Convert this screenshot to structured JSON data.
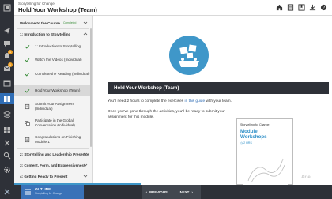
{
  "header": {
    "breadcrumb": "Storytelling for Change",
    "title": "Hold Your Workshop (Team)",
    "icons": [
      "home-icon",
      "notes-icon",
      "bookmark-icon",
      "download-icon",
      "help-icon"
    ]
  },
  "rail": {
    "icons": [
      "logo-icon",
      "send-icon",
      "chat-icon",
      "bell-icon",
      "mail-icon",
      "calendar-icon",
      "book-icon",
      "stack-icon",
      "grid-icon",
      "layers-icon",
      "search-icon",
      "settings-icon"
    ],
    "badges": [
      "1",
      "1"
    ]
  },
  "sidebar": {
    "welcome": {
      "label": "Welcome to the Course",
      "tag": "Completed"
    },
    "module1": {
      "label": "1: Introduction to Storytelling",
      "items": [
        {
          "label": "1: Introduction to Storytelling",
          "status": "done"
        },
        {
          "label": "Watch the Videos (Individual)",
          "status": "done"
        },
        {
          "label": "Complete the Reading (Individual)",
          "status": "done"
        },
        {
          "label": "Hold Your Workshop (Team)",
          "status": "current"
        },
        {
          "label": "Submit Your Assignment (Individual)",
          "status": "todo"
        },
        {
          "label": "Participate in the Global Conversation (Individual)",
          "status": "todo"
        },
        {
          "label": "Congratulations on Finishing Module 1",
          "status": "todo"
        }
      ]
    },
    "modules": [
      "2: Storytelling and Leadership Presence",
      "3: Content, Form, and Expressiveness",
      "4: Getting Ready to Present"
    ]
  },
  "main": {
    "banner": "Hold Your Workshop (Team)",
    "para1_pre": "You'll need 2 hours to complete the exercises ",
    "para1_link": "in this guide",
    "para1_post": " with your team.",
    "para2": "Once you've gone through the activities, you'll be ready to submit your assignment for this module.",
    "book": {
      "series": "Storytelling for Change",
      "title_line1": "Module",
      "title_line2": "Workshops",
      "meta": "2 HRS"
    },
    "logo": "Ariel"
  },
  "bottombar": {
    "outline_label": "OUTLINE",
    "outline_sub": "Storytelling for Change",
    "previous_label": "PREVIOUS",
    "next_label": "NEXT"
  },
  "colors": {
    "accent": "#3f97c9",
    "rail": "#2e3138",
    "outline": "#3a72b8",
    "check": "#3a8d3a"
  }
}
